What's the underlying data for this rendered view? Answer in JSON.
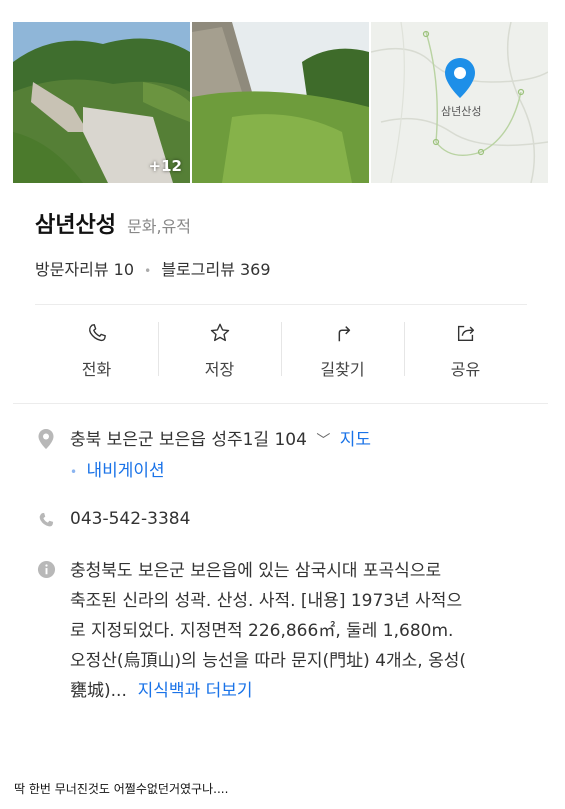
{
  "photos": {
    "more_count": "+12"
  },
  "map": {
    "marker_label": "삼년산성"
  },
  "place": {
    "name": "삼년산성",
    "category": "문화,유적"
  },
  "reviews": {
    "visitor": "방문자리뷰 10",
    "blog": "블로그리뷰 369"
  },
  "actions": [
    {
      "label": "전화",
      "icon": "phone-icon"
    },
    {
      "label": "저장",
      "icon": "star-icon"
    },
    {
      "label": "길찾기",
      "icon": "directions-icon"
    },
    {
      "label": "공유",
      "icon": "share-icon"
    }
  ],
  "address": {
    "text": "충북 보은군 보은읍 성주1길 104",
    "map_link": "지도",
    "navigation_link": "내비게이션"
  },
  "phone": "043-542-3384",
  "description": {
    "lines": [
      "충청북도 보은군 보은읍에 있는 삼국시대 포곡식으로",
      "축조된 신라의 성곽. 산성. 사적. [내용] 1973년 사적으",
      "로 지정되었다. 지정면적 226,866㎡, 둘레 1,680m.",
      "오정산(烏頂山)의 능선을 따라 문지(門址) 4개소, 옹성(",
      "甕城)..."
    ],
    "more_link": "지식백과 더보기"
  },
  "caption": "딱 한번 무너진것도 어쩔수없던거였구나....",
  "colors": {
    "link": "#1a73e8",
    "marker": "#1e8fe8",
    "divider": "#ececec"
  }
}
